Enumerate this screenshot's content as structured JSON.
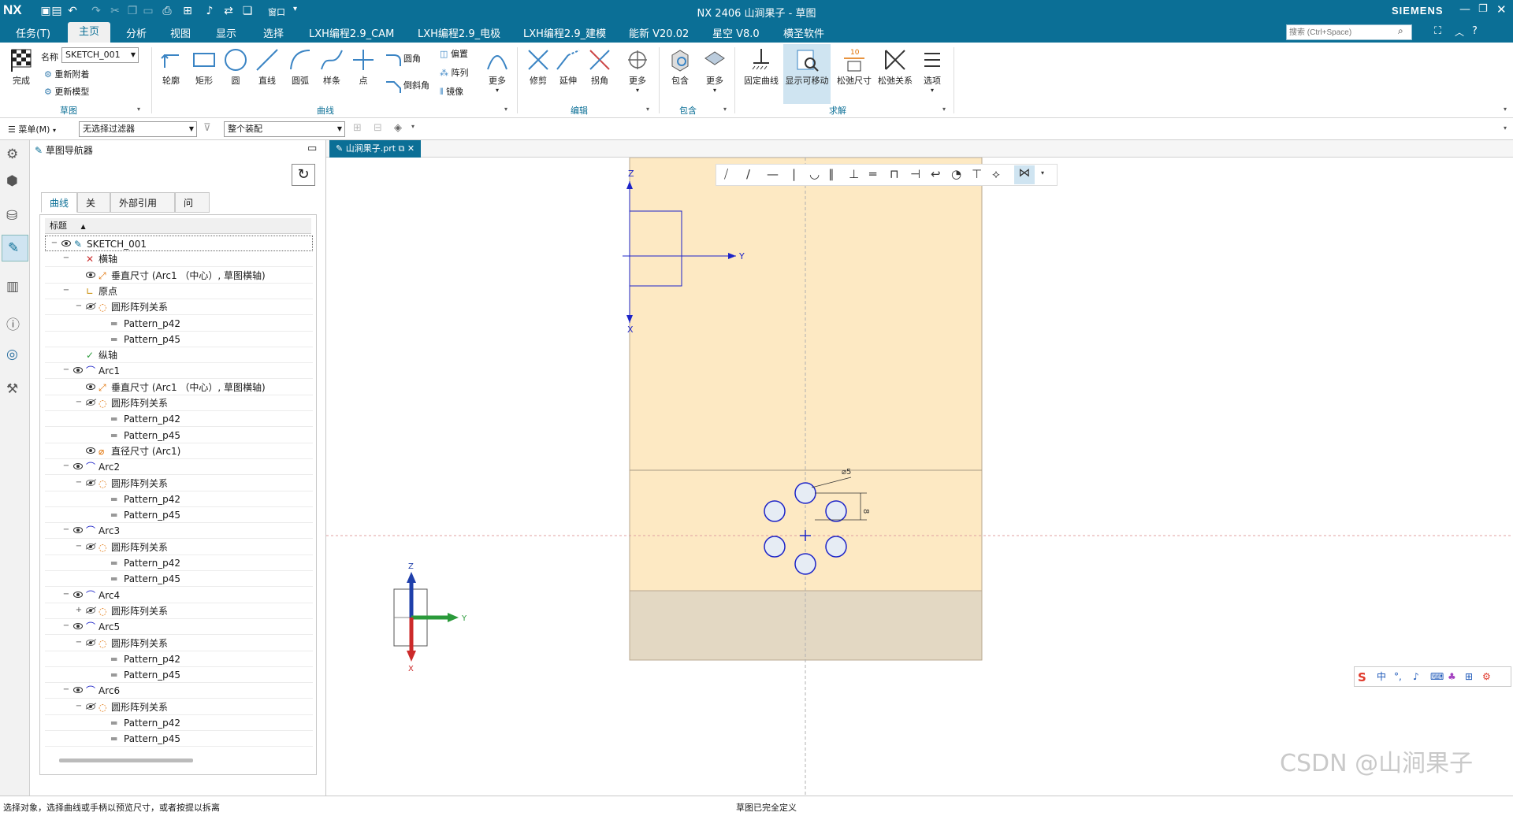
{
  "titlebar": {
    "app_logo": "NX",
    "title": "NX 2406 山涧果子 - 草图",
    "brand": "SIEMENS",
    "window_menu": "窗口",
    "icons": [
      "save-icon",
      "save-as-icon",
      "undo-icon",
      "redo-icon",
      "copy-icon",
      "paste-icon",
      "print-icon",
      "grid-icon",
      "mic-icon",
      "link-icon",
      "windows-icon"
    ]
  },
  "menubar": {
    "items": [
      "任务(T)",
      "主页",
      "分析",
      "视图",
      "显示",
      "选择",
      "LXH编程2.9_CAM",
      "LXH编程2.9_电极",
      "LXH编程2.9_建模",
      "能新 V20.02",
      "星空 V8.0",
      "横圣软件"
    ],
    "active": "主页",
    "search_placeholder": "搜索 (Ctrl+Space)"
  },
  "ribbon": {
    "finish_label": "完成",
    "name_label": "名称",
    "sketch_name": "SKETCH_001",
    "reattach_label": "重新附着",
    "update_model_label": "更新模型",
    "curve_tools": [
      "轮廓",
      "矩形",
      "圆",
      "直线",
      "圆弧",
      "样条",
      "点"
    ],
    "fillet_label": "圆角",
    "chamfer_label": "倒斜角",
    "offset_label": "偏置",
    "pattern_label": "阵列",
    "mirror_label": "镜像",
    "more_label": "更多",
    "edit_tools": [
      "修剪",
      "延伸",
      "拐角"
    ],
    "include_label": "包含",
    "solve_tools": [
      "固定曲线",
      "显示可移动",
      "松弛尺寸",
      "松弛关系",
      "选项"
    ],
    "groups": [
      "草图",
      "曲线",
      "编辑",
      "包含",
      "求解"
    ]
  },
  "filterbar": {
    "menu_label": "菜单(M)",
    "filter_value": "无选择过滤器",
    "assembly_value": "整个装配"
  },
  "navigator": {
    "title": "草图导航器",
    "tabs": [
      "曲线",
      "关系",
      "外部引用",
      "问题"
    ],
    "active_tab": "曲线",
    "column_header": "标题",
    "rows": [
      {
        "level": 0,
        "label": "SKETCH_001",
        "icon": "sketch-icon",
        "eye": true,
        "toggle": "-"
      },
      {
        "level": 1,
        "label": "横轴",
        "icon": "axis-x-icon",
        "eye": false,
        "toggle": "-"
      },
      {
        "level": 2,
        "label": "垂直尺寸 (Arc1 （中心）, 草图横轴)",
        "icon": "dimension-icon",
        "eye": true,
        "toggle": ""
      },
      {
        "level": 1,
        "label": "原点",
        "icon": "origin-icon",
        "eye": false,
        "toggle": "-"
      },
      {
        "level": 2,
        "label": "圆形阵列关系",
        "icon": "circular-pattern-icon",
        "eye": "hidden",
        "toggle": "-"
      },
      {
        "level": 3,
        "label": "Pattern_p42",
        "icon": "equal-icon",
        "eye": false,
        "toggle": ""
      },
      {
        "level": 3,
        "label": "Pattern_p45",
        "icon": "equal-icon",
        "eye": false,
        "toggle": ""
      },
      {
        "level": 1,
        "label": "纵轴",
        "icon": "axis-y-icon",
        "eye": false,
        "toggle": ""
      },
      {
        "level": 1,
        "label": "Arc1",
        "icon": "arc-icon",
        "eye": true,
        "toggle": "-"
      },
      {
        "level": 2,
        "label": "垂直尺寸 (Arc1 （中心）, 草图横轴)",
        "icon": "dimension-icon",
        "eye": true,
        "toggle": ""
      },
      {
        "level": 2,
        "label": "圆形阵列关系",
        "icon": "circular-pattern-icon",
        "eye": "hidden",
        "toggle": "-"
      },
      {
        "level": 3,
        "label": "Pattern_p42",
        "icon": "equal-icon",
        "eye": false,
        "toggle": ""
      },
      {
        "level": 3,
        "label": "Pattern_p45",
        "icon": "equal-icon",
        "eye": false,
        "toggle": ""
      },
      {
        "level": 2,
        "label": "直径尺寸 (Arc1)",
        "icon": "diameter-icon",
        "eye": true,
        "toggle": ""
      },
      {
        "level": 1,
        "label": "Arc2",
        "icon": "arc-icon",
        "eye": true,
        "toggle": "-"
      },
      {
        "level": 2,
        "label": "圆形阵列关系",
        "icon": "circular-pattern-icon",
        "eye": "hidden",
        "toggle": "-"
      },
      {
        "level": 3,
        "label": "Pattern_p42",
        "icon": "equal-icon",
        "eye": false,
        "toggle": ""
      },
      {
        "level": 3,
        "label": "Pattern_p45",
        "icon": "equal-icon",
        "eye": false,
        "toggle": ""
      },
      {
        "level": 1,
        "label": "Arc3",
        "icon": "arc-icon",
        "eye": true,
        "toggle": "-"
      },
      {
        "level": 2,
        "label": "圆形阵列关系",
        "icon": "circular-pattern-icon",
        "eye": "hidden",
        "toggle": "-"
      },
      {
        "level": 3,
        "label": "Pattern_p42",
        "icon": "equal-icon",
        "eye": false,
        "toggle": ""
      },
      {
        "level": 3,
        "label": "Pattern_p45",
        "icon": "equal-icon",
        "eye": false,
        "toggle": ""
      },
      {
        "level": 1,
        "label": "Arc4",
        "icon": "arc-icon",
        "eye": true,
        "toggle": "-"
      },
      {
        "level": 2,
        "label": "圆形阵列关系",
        "icon": "circular-pattern-icon",
        "eye": "hidden",
        "toggle": "+"
      },
      {
        "level": 1,
        "label": "Arc5",
        "icon": "arc-icon",
        "eye": true,
        "toggle": "-"
      },
      {
        "level": 2,
        "label": "圆形阵列关系",
        "icon": "circular-pattern-icon",
        "eye": "hidden",
        "toggle": "-"
      },
      {
        "level": 3,
        "label": "Pattern_p42",
        "icon": "equal-icon",
        "eye": false,
        "toggle": ""
      },
      {
        "level": 3,
        "label": "Pattern_p45",
        "icon": "equal-icon",
        "eye": false,
        "toggle": ""
      },
      {
        "level": 1,
        "label": "Arc6",
        "icon": "arc-icon",
        "eye": true,
        "toggle": "-"
      },
      {
        "level": 2,
        "label": "圆形阵列关系",
        "icon": "circular-pattern-icon",
        "eye": "hidden",
        "toggle": "-"
      },
      {
        "level": 3,
        "label": "Pattern_p42",
        "icon": "equal-icon",
        "eye": false,
        "toggle": ""
      },
      {
        "level": 3,
        "label": "Pattern_p45",
        "icon": "equal-icon",
        "eye": false,
        "toggle": ""
      }
    ]
  },
  "graphics": {
    "tab_label": "山涧果子.prt",
    "dim_diameter": "⌀5",
    "dim_vertical": "8",
    "axis_z": "Z",
    "axis_y": "Y",
    "axis_x": "X",
    "triad_z": "Z",
    "triad_y": "Y",
    "triad_x": "X",
    "watermark": "CSDN @山涧果子",
    "ime_items": [
      "中",
      "°,",
      "mic",
      "keyboard",
      "shirt",
      "grid",
      "tool"
    ]
  },
  "status": {
    "left": "选择对象，选择曲线或手柄以预览尺寸，或者按提以拆离",
    "center": "草图已完全定义"
  },
  "colors": {
    "titlebar": "#0b6f96",
    "sketch_region": "#fde9c3",
    "lower_region": "#e3d8c3",
    "sketch_blue": "#1d24c8",
    "accent": "#0b6f96"
  }
}
